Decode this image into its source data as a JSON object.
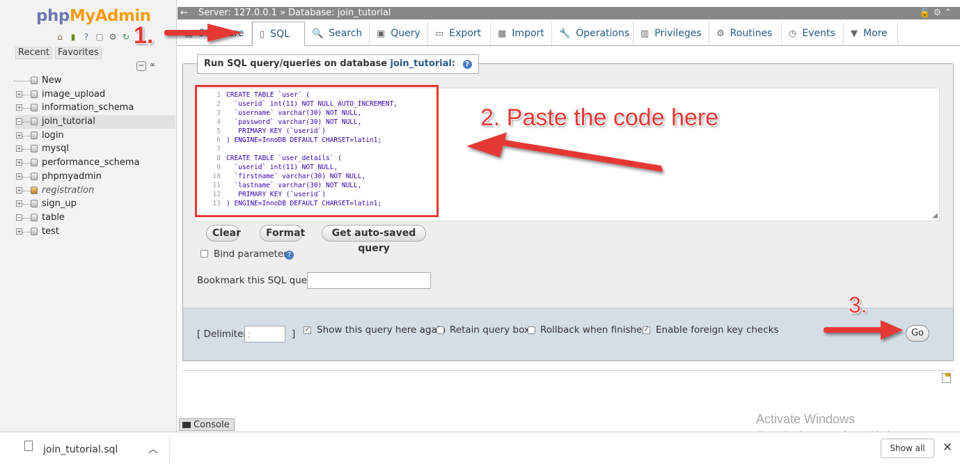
{
  "nav": {
    "logo_php": "php",
    "logo_myadmin": "MyAdmin",
    "tabs": [
      "Recent",
      "Favorites"
    ],
    "databases": [
      {
        "name": "New",
        "type": "new"
      },
      {
        "name": "image_upload"
      },
      {
        "name": "information_schema"
      },
      {
        "name": "join_tutorial",
        "active": true
      },
      {
        "name": "login"
      },
      {
        "name": "mysql"
      },
      {
        "name": "performance_schema"
      },
      {
        "name": "phpmyadmin"
      },
      {
        "name": "registration",
        "italic": true
      },
      {
        "name": "sign_up"
      },
      {
        "name": "table"
      },
      {
        "name": "test"
      }
    ]
  },
  "topbar": {
    "back": "←",
    "breadcrumb": "Server: 127.0.0.1 » Database: join_tutorial"
  },
  "tabs": [
    {
      "label": "Structure",
      "icon": "structure-icon"
    },
    {
      "label": "SQL",
      "icon": "sql-icon",
      "active": true
    },
    {
      "label": "Search",
      "icon": "search-icon"
    },
    {
      "label": "Query",
      "icon": "query-icon"
    },
    {
      "label": "Export",
      "icon": "export-icon"
    },
    {
      "label": "Import",
      "icon": "import-icon"
    },
    {
      "label": "Operations",
      "icon": "wrench-icon"
    },
    {
      "label": "Privileges",
      "icon": "privileges-icon"
    },
    {
      "label": "Routines",
      "icon": "routines-icon"
    },
    {
      "label": "Events",
      "icon": "clock-icon"
    },
    {
      "label": "More",
      "icon": "triangle-down-icon"
    }
  ],
  "query": {
    "legend_prefix": "Run SQL query/queries on database",
    "legend_db": "join_tutorial:",
    "code_lines": [
      "CREATE TABLE `user` (",
      "  `userid` int(11) NOT NULL AUTO_INCREMENT,",
      "  `username` varchar(30) NOT NULL,",
      "  `password` varchar(30) NOT NULL,",
      "   PRIMARY KEY (`userid`)",
      ") ENGINE=InnoDB DEFAULT CHARSET=latin1;",
      "",
      "CREATE TABLE `user_details` (",
      "  `userid` int(11) NOT NULL,",
      "  `firstname` varchar(30) NOT NULL,",
      "  `lastname` varchar(30) NOT NULL,",
      "   PRIMARY KEY (`userid`)",
      ") ENGINE=InnoDB DEFAULT CHARSET=latin1;"
    ],
    "buttons": {
      "clear": "Clear",
      "format": "Format",
      "autosaved": "Get auto-saved query"
    },
    "bind_parameters": "Bind parameters",
    "bookmark_label": "Bookmark this SQL query:",
    "bookmark_value": ""
  },
  "footer": {
    "delimiter_label": "[ Delimiter",
    "delimiter_close": "]",
    "delimiter_value": ";",
    "show_query": "Show this query here again",
    "retain_box": "Retain query box",
    "rollback": "Rollback when finished",
    "foreign_key": "Enable foreign key checks",
    "go": "Go"
  },
  "annotations": {
    "step1": "1.",
    "step2": "2. Paste the code here",
    "step3": "3.",
    "color": "#e53935"
  },
  "console": {
    "label": "Console"
  },
  "watermark": {
    "line1": "Activate Windows",
    "line2": "Go to Settings to activate Windows."
  },
  "downloads": {
    "filename": "join_tutorial.sql",
    "show_all": "Show all"
  }
}
